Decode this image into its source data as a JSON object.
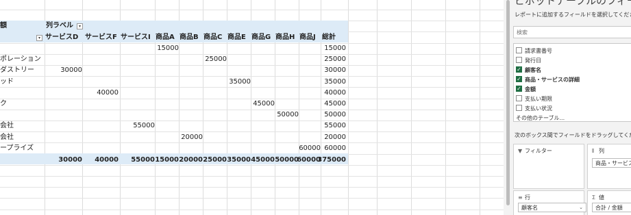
{
  "pivot": {
    "row_header": "額",
    "col_label": "列ラベル",
    "columns": [
      "サービスD",
      "サービスF",
      "サービスI",
      "商品A",
      "商品B",
      "商品C",
      "商品E",
      "商品G",
      "商品H",
      "商品J",
      "総計"
    ],
    "rows": [
      {
        "label": "",
        "values": [
          "",
          "",
          "",
          "15000",
          "",
          "",
          "",
          "",
          "",
          "",
          "15000"
        ]
      },
      {
        "label": "ポレーション",
        "values": [
          "",
          "",
          "",
          "",
          "",
          "25000",
          "",
          "",
          "",
          "",
          "25000"
        ]
      },
      {
        "label": "ダストリー",
        "values": [
          "30000",
          "",
          "",
          "",
          "",
          "",
          "",
          "",
          "",
          "",
          "30000"
        ]
      },
      {
        "label": "ッド",
        "values": [
          "",
          "",
          "",
          "",
          "",
          "",
          "35000",
          "",
          "",
          "",
          "35000"
        ]
      },
      {
        "label": "",
        "values": [
          "",
          "40000",
          "",
          "",
          "",
          "",
          "",
          "",
          "",
          "",
          "40000"
        ]
      },
      {
        "label": "ク",
        "values": [
          "",
          "",
          "",
          "",
          "",
          "",
          "",
          "45000",
          "",
          "",
          "45000"
        ]
      },
      {
        "label": "",
        "values": [
          "",
          "",
          "",
          "",
          "",
          "",
          "",
          "",
          "50000",
          "",
          "50000"
        ]
      },
      {
        "label": "会社",
        "values": [
          "",
          "",
          "55000",
          "",
          "",
          "",
          "",
          "",
          "",
          "",
          "55000"
        ]
      },
      {
        "label": "会社",
        "values": [
          "",
          "",
          "",
          "",
          "20000",
          "",
          "",
          "",
          "",
          "",
          "20000"
        ]
      },
      {
        "label": "ープライズ",
        "values": [
          "",
          "",
          "",
          "",
          "",
          "",
          "",
          "",
          "",
          "60000",
          "60000"
        ]
      }
    ],
    "totals": [
      "30000",
      "40000",
      "55000",
      "15000",
      "20000",
      "25000",
      "35000",
      "45000",
      "50000",
      "60000",
      "375000"
    ]
  },
  "pane": {
    "title": "ピボットテーブルのフィールド",
    "instruction": "レポートに追加するフィールドを選択してください:",
    "search_placeholder": "検索",
    "fields": [
      {
        "label": "請求書番号",
        "checked": false
      },
      {
        "label": "発行日",
        "checked": false
      },
      {
        "label": "顧客名",
        "checked": true
      },
      {
        "label": "商品・サービスの詳細",
        "checked": true
      },
      {
        "label": "金額",
        "checked": true
      },
      {
        "label": "支払い期限",
        "checked": false
      },
      {
        "label": "支払い状況",
        "checked": false
      },
      {
        "label": "その他のテーブル...",
        "checked": null
      }
    ],
    "drag_instruction": "次のボックス間でフィールドをドラッグしてください:",
    "areas": {
      "filter": {
        "label": "フィルター"
      },
      "columns": {
        "label": "列",
        "chip": "商品・サービスの詳細"
      },
      "rows": {
        "label": "行",
        "chip": "顧客名"
      },
      "values": {
        "label": "値",
        "chip": "合計 / 金額"
      }
    }
  },
  "colors": {
    "accent": "#1f6e43",
    "band": "#ddebf7"
  }
}
